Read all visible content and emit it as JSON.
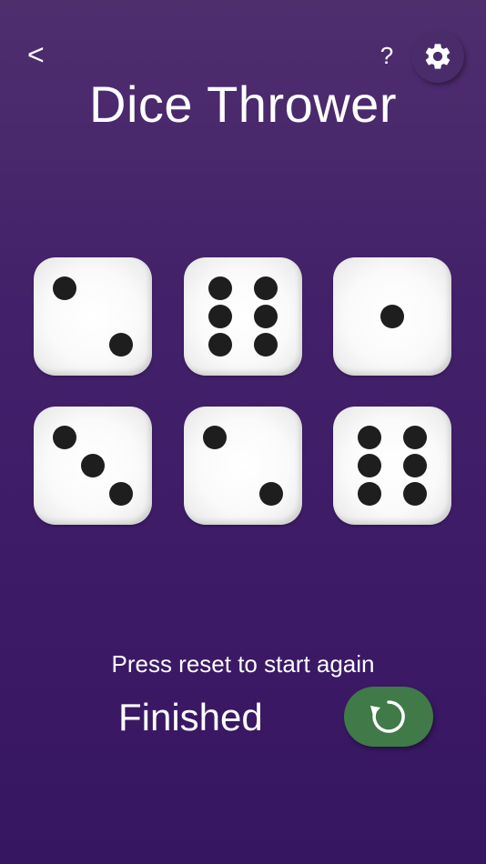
{
  "header": {
    "back_label": "<",
    "help_label": "?",
    "settings_icon": "gear-icon",
    "title": "Dice Thrower"
  },
  "dice": [
    {
      "value": 2
    },
    {
      "value": 6
    },
    {
      "value": 1
    },
    {
      "value": 3
    },
    {
      "value": 2
    },
    {
      "value": 6
    }
  ],
  "footer": {
    "message": "Press reset to start again",
    "status": "Finished",
    "reset_icon": "reset-icon",
    "reset_color": "#3f7a48"
  }
}
